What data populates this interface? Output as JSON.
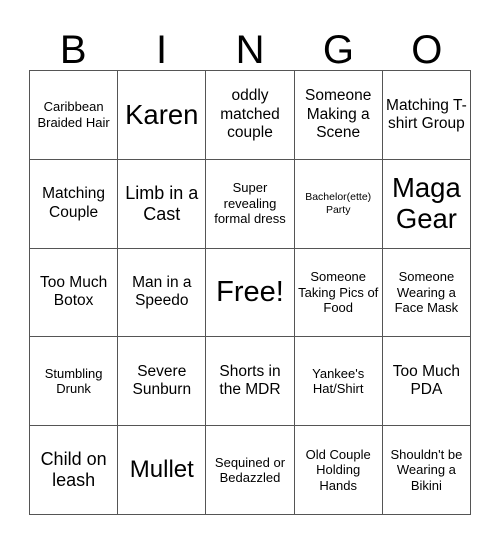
{
  "card": {
    "title_letters": [
      "B",
      "I",
      "N",
      "G",
      "O"
    ],
    "rows": [
      [
        {
          "text": "Caribbean Braided Hair",
          "size": "sm"
        },
        {
          "text": "Karen",
          "size": "xxl"
        },
        {
          "text": "oddly matched couple",
          "size": "md"
        },
        {
          "text": "Someone Making a Scene",
          "size": "md"
        },
        {
          "text": "Matching T-shirt Group",
          "size": "md"
        }
      ],
      [
        {
          "text": "Matching Couple",
          "size": "md"
        },
        {
          "text": "Limb in a Cast",
          "size": "lg"
        },
        {
          "text": "Super revealing formal dress",
          "size": "sm"
        },
        {
          "text": "Bachelor(ette) Party",
          "size": "xs"
        },
        {
          "text": "Maga Gear",
          "size": "xxl"
        }
      ],
      [
        {
          "text": "Too Much Botox",
          "size": "md"
        },
        {
          "text": "Man in a Speedo",
          "size": "md"
        },
        {
          "text": "Free!",
          "size": "free"
        },
        {
          "text": "Someone Taking Pics of Food",
          "size": "sm"
        },
        {
          "text": "Someone Wearing a Face Mask",
          "size": "sm"
        }
      ],
      [
        {
          "text": "Stumbling Drunk",
          "size": "sm"
        },
        {
          "text": "Severe Sunburn",
          "size": "md"
        },
        {
          "text": "Shorts in the MDR",
          "size": "md"
        },
        {
          "text": "Yankee's Hat/Shirt",
          "size": "sm"
        },
        {
          "text": "Too Much PDA",
          "size": "md"
        }
      ],
      [
        {
          "text": "Child on leash",
          "size": "lg"
        },
        {
          "text": "Mullet",
          "size": "xl"
        },
        {
          "text": "Sequined or Bedazzled",
          "size": "sm"
        },
        {
          "text": "Old Couple Holding Hands",
          "size": "sm"
        },
        {
          "text": "Shouldn't be Wearing a Bikini",
          "size": "sm"
        }
      ]
    ],
    "colors": {
      "background": "#ffffff",
      "text": "#000000",
      "grid_line": "#555555"
    }
  }
}
